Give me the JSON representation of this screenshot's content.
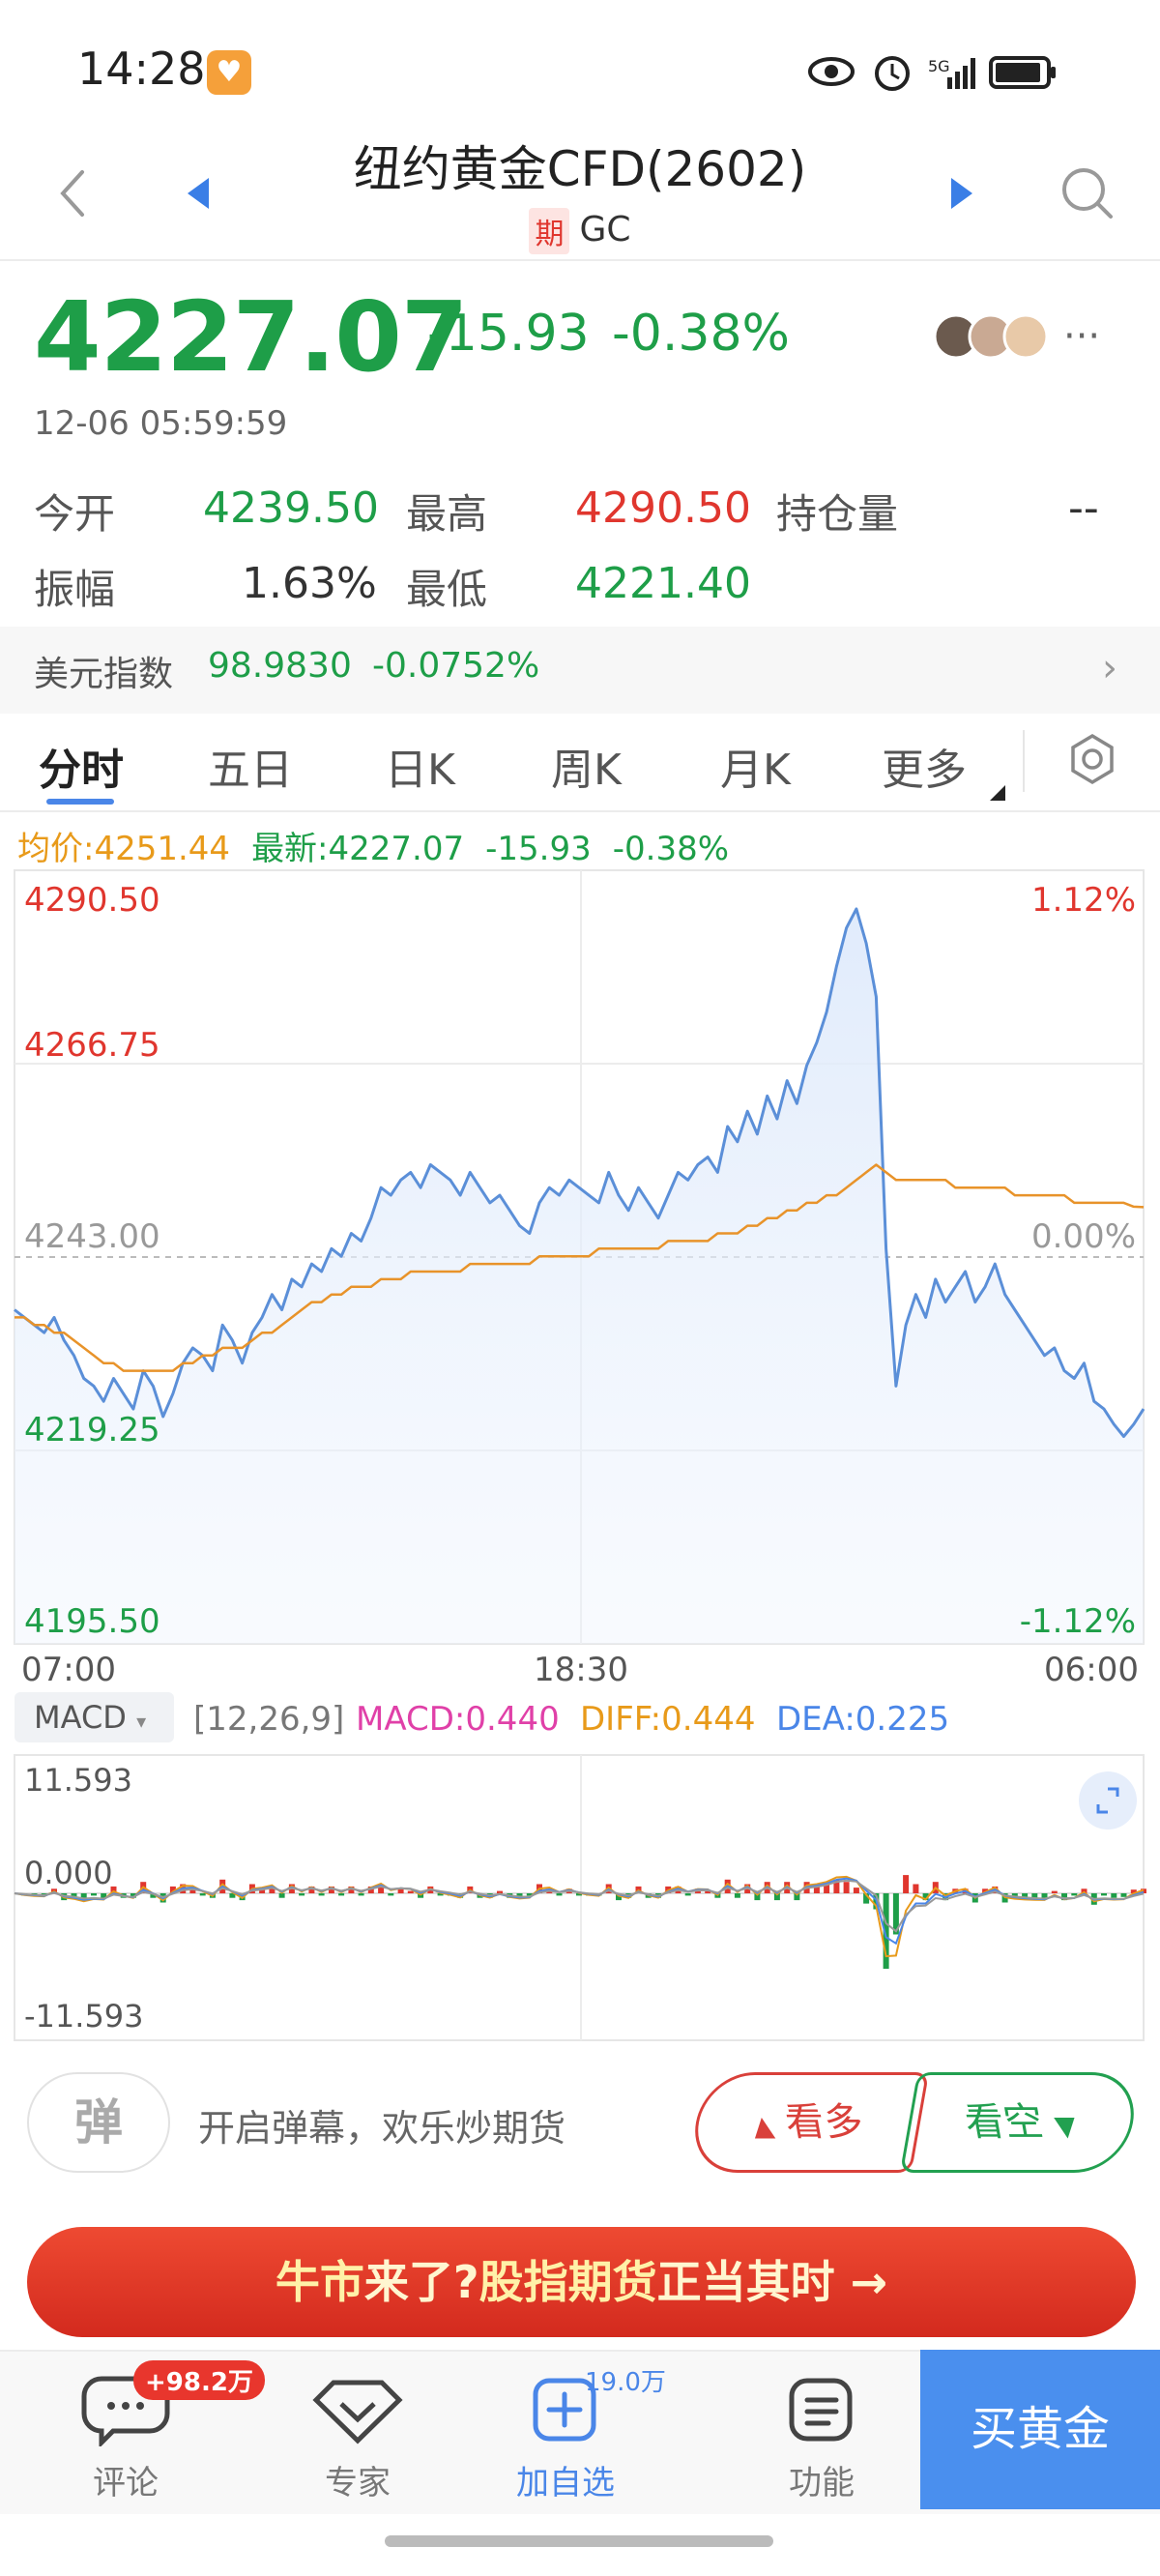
{
  "status_bar": {
    "time": "14:28",
    "network": "5G"
  },
  "header": {
    "title": "纽约黄金CFD(2602)",
    "tag": "期",
    "code": "GC"
  },
  "quote": {
    "price": "4227.07",
    "change": "-15.93",
    "change_pct": "-0.38%",
    "timestamp": "12-06 05:59:59",
    "more": "···"
  },
  "stats": {
    "open_label": "今开",
    "open_value": "4239.50",
    "high_label": "最高",
    "high_value": "4290.50",
    "oi_label": "持仓量",
    "oi_value": "--",
    "amp_label": "振幅",
    "amp_value": "1.63%",
    "low_label": "最低",
    "low_value": "4221.40"
  },
  "usd_index": {
    "label": "美元指数",
    "value": "98.9830",
    "change_pct": "-0.0752%"
  },
  "tabs": [
    {
      "label": "分时"
    },
    {
      "label": "五日"
    },
    {
      "label": "日K"
    },
    {
      "label": "周K"
    },
    {
      "label": "月K"
    },
    {
      "label": "更多"
    }
  ],
  "chart_info": {
    "avg": "均价:4251.44",
    "latest": "最新:4227.07",
    "change": "-15.93",
    "pct": "-0.38%"
  },
  "chart_data": {
    "type": "line",
    "y_left_ticks": [
      "4290.50",
      "4266.75",
      "4243.00",
      "4219.25",
      "4195.50"
    ],
    "y_right_ticks": [
      "1.12%",
      "0.00%",
      "-1.12%"
    ],
    "x_ticks": [
      "07:00",
      "18:30",
      "06:00"
    ],
    "ylim": [
      4195.5,
      4290.5
    ],
    "prev_close": 4243.0,
    "series": [
      {
        "name": "最新",
        "color": "#5b8fd8",
        "values": [
          4238,
          4237,
          4236,
          4235,
          4237,
          4234,
          4232,
          4229,
          4228,
          4226,
          4229,
          4227,
          4225,
          4230,
          4228,
          4224,
          4227,
          4231,
          4233,
          4232,
          4230,
          4236,
          4234,
          4231,
          4235,
          4237,
          4240,
          4238,
          4242,
          4241,
          4244,
          4243,
          4246,
          4245,
          4248,
          4247,
          4250,
          4254,
          4253,
          4255,
          4256,
          4254,
          4257,
          4256,
          4255,
          4253,
          4256,
          4254,
          4252,
          4253,
          4251,
          4249,
          4248,
          4252,
          4254,
          4253,
          4255,
          4254,
          4253,
          4252,
          4256,
          4253,
          4251,
          4254,
          4252,
          4250,
          4253,
          4256,
          4255,
          4257,
          4258,
          4256,
          4262,
          4260,
          4264,
          4261,
          4266,
          4263,
          4268,
          4265,
          4270,
          4273,
          4277,
          4283,
          4288,
          4290.5,
          4286,
          4279,
          4246,
          4228,
          4236,
          4240,
          4237,
          4242,
          4239,
          4241,
          4243,
          4239,
          4241,
          4244,
          4240,
          4238,
          4236,
          4234,
          4232,
          4233,
          4230,
          4229,
          4231,
          4226,
          4225,
          4223,
          4221.4,
          4223,
          4225
        ]
      },
      {
        "name": "均价",
        "color": "#e8932a",
        "values": [
          4237,
          4237,
          4236,
          4236,
          4235,
          4235,
          4234,
          4233,
          4232,
          4231,
          4231,
          4230,
          4230,
          4230,
          4230,
          4230,
          4230,
          4231,
          4231,
          4232,
          4232,
          4233,
          4233,
          4233,
          4234,
          4235,
          4235,
          4236,
          4237,
          4238,
          4239,
          4239,
          4240,
          4240,
          4241,
          4241,
          4241,
          4242,
          4242,
          4242,
          4243,
          4243,
          4243,
          4243,
          4243,
          4243,
          4244,
          4244,
          4244,
          4244,
          4244,
          4244,
          4244,
          4245,
          4245,
          4245,
          4245,
          4245,
          4245,
          4246,
          4246,
          4246,
          4246,
          4246,
          4246,
          4246,
          4247,
          4247,
          4247,
          4247,
          4247,
          4248,
          4248,
          4248,
          4249,
          4249,
          4250,
          4250,
          4251,
          4251,
          4252,
          4252,
          4253,
          4253,
          4254,
          4255,
          4256,
          4257,
          4256,
          4255,
          4255,
          4255,
          4255,
          4255,
          4255,
          4254,
          4254,
          4254,
          4254,
          4254,
          4254,
          4253,
          4253,
          4253,
          4253,
          4253,
          4253,
          4252,
          4252,
          4252,
          4252,
          4252,
          4252,
          4251.5,
          4251.44
        ]
      }
    ]
  },
  "macd": {
    "select": "MACD",
    "params": "[12,26,9]",
    "macd": "MACD:0.440",
    "diff": "DIFF:0.444",
    "dea": "DEA:0.225",
    "y_ticks": [
      "11.593",
      "0.000",
      "-11.593"
    ]
  },
  "actions": {
    "danmu_icon": "弹",
    "danmu_text": "开启弹幕，欢乐炒期货",
    "bull": "看多",
    "bear": "看空"
  },
  "banner": {
    "part1": "牛市",
    "part2": "来了?",
    "part3": "股指期货",
    "part4": "正当其时",
    "arrow": "→"
  },
  "bottom_nav": {
    "comment": "评论",
    "comment_badge": "+98.2万",
    "expert": "专家",
    "add": "加自选",
    "add_count": "19.0万",
    "func": "功能",
    "buy": "买黄金"
  },
  "colors": {
    "up": "#e0362e",
    "down": "#1e9e48",
    "accent": "#4a86e8"
  }
}
